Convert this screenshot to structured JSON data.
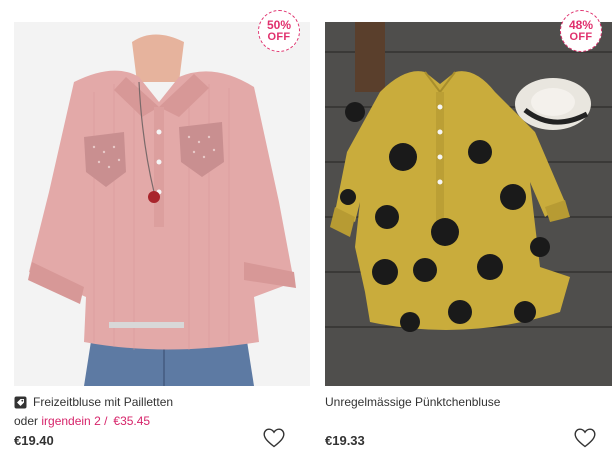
{
  "products": [
    {
      "title": "Freizeitbluse mit Pailletten",
      "badge_percent": "50%",
      "badge_off": "OFF",
      "bundle_prefix": "oder ",
      "bundle_link": "irgendein 2 /",
      "bundle_price": "€35.45",
      "price": "€19.40",
      "colors": {
        "shirt": "#e3a9a8",
        "background": "#f2f2f2"
      }
    },
    {
      "title": "Unregelmässige Pünktchenbluse",
      "badge_percent": "48%",
      "badge_off": "OFF",
      "price": "€19.33",
      "colors": {
        "shirt": "#c9ac3c",
        "dots": "#1a1a1a",
        "background": "#53514f"
      }
    }
  ],
  "colors": {
    "accent": "#e0306d",
    "text": "#333333"
  },
  "icons": {
    "tag": "tag-icon",
    "wishlist": "heart-icon"
  }
}
